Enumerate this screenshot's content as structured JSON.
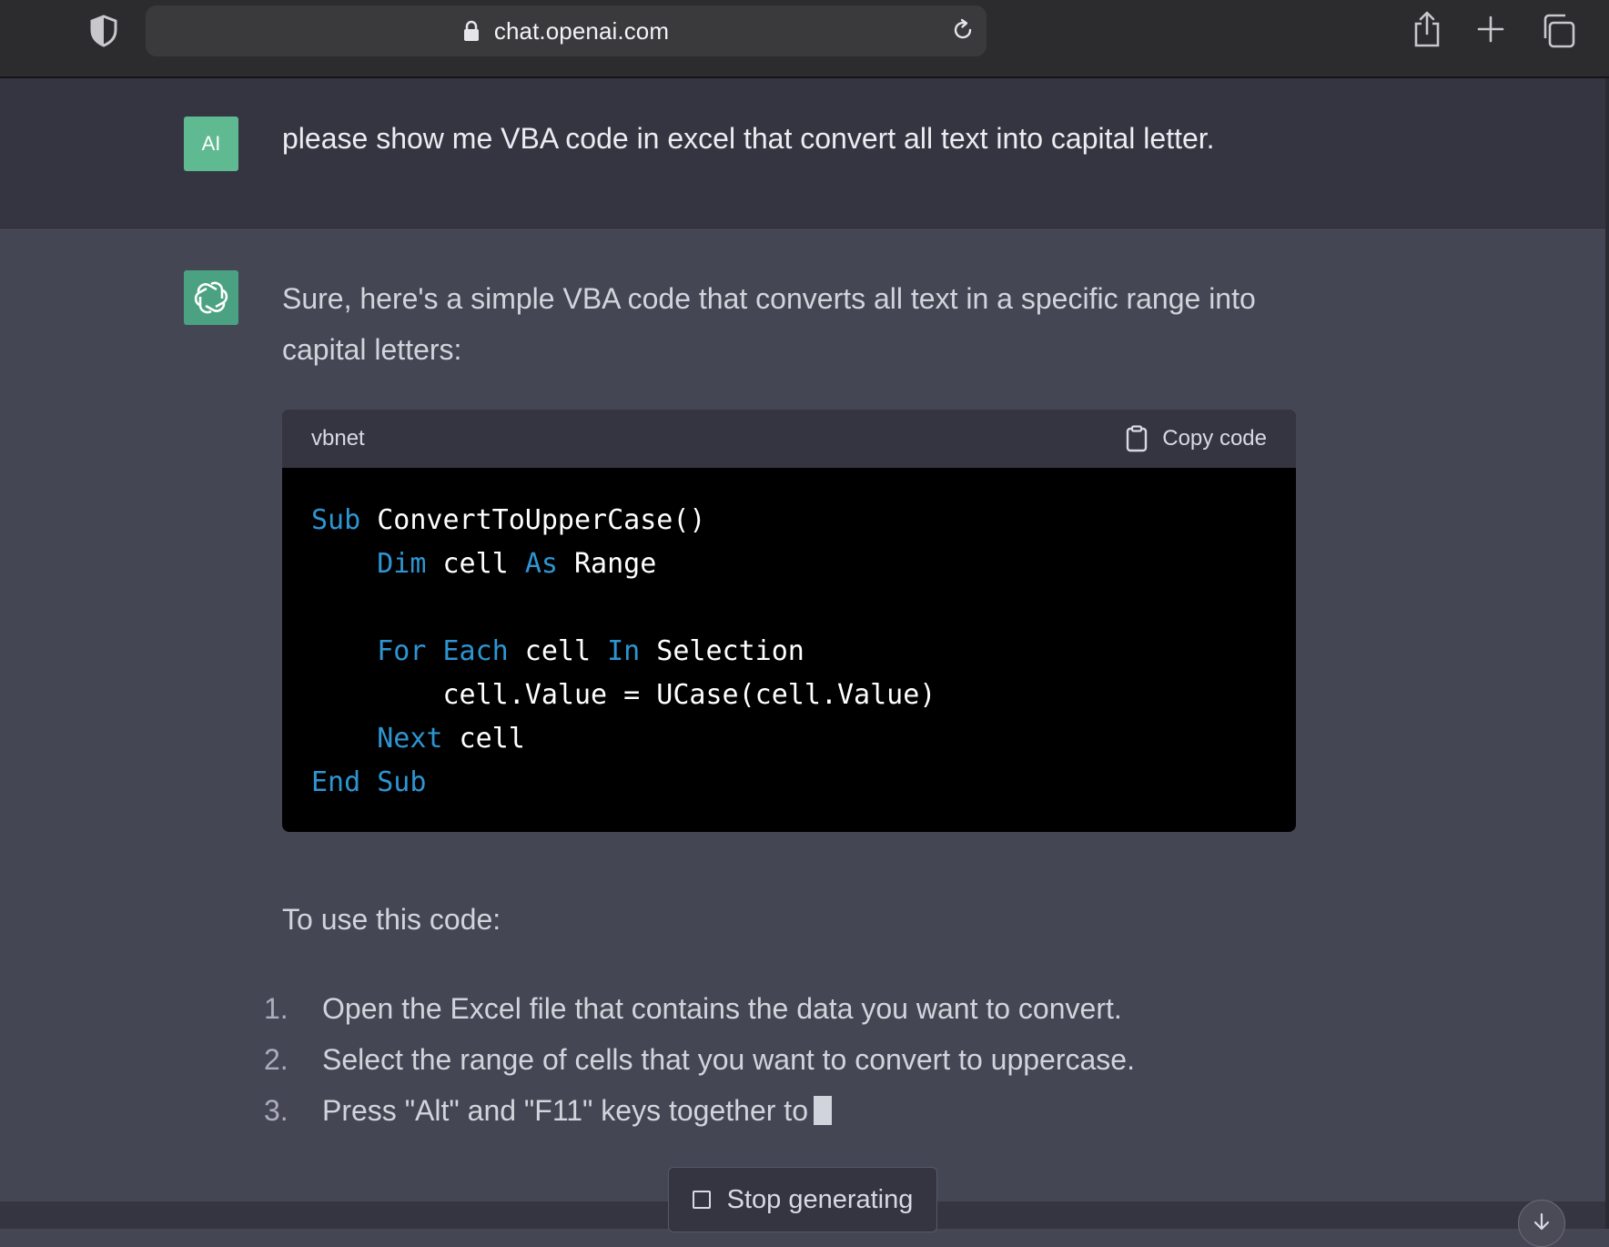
{
  "browser": {
    "url": "chat.openai.com"
  },
  "conversation": {
    "user": {
      "avatar_label": "AI",
      "message": "please show me VBA code in excel that convert all text into capital letter."
    },
    "assistant": {
      "intro": "Sure, here's a simple VBA code that converts all text in a specific range into capital letters:",
      "code_block": {
        "language": "vbnet",
        "copy_label": "Copy code",
        "lines": [
          [
            {
              "t": "Sub",
              "k": true
            },
            {
              "t": " ConvertToUpperCase()"
            }
          ],
          [
            {
              "t": "    "
            },
            {
              "t": "Dim",
              "k": true
            },
            {
              "t": " cell "
            },
            {
              "t": "As",
              "k": true
            },
            {
              "t": " Range"
            }
          ],
          [
            {
              "t": ""
            }
          ],
          [
            {
              "t": "    "
            },
            {
              "t": "For",
              "k": true
            },
            {
              "t": " "
            },
            {
              "t": "Each",
              "k": true
            },
            {
              "t": " cell "
            },
            {
              "t": "In",
              "k": true
            },
            {
              "t": " Selection"
            }
          ],
          [
            {
              "t": "        cell.Value = UCase(cell.Value)"
            }
          ],
          [
            {
              "t": "    "
            },
            {
              "t": "Next",
              "k": true
            },
            {
              "t": " cell"
            }
          ],
          [
            {
              "t": "End",
              "k": true
            },
            {
              "t": " "
            },
            {
              "t": "Sub",
              "k": true
            }
          ]
        ]
      },
      "use_label": "To use this code:",
      "steps": [
        {
          "num": "1.",
          "text": "Open the Excel file that contains the data you want to convert."
        },
        {
          "num": "2.",
          "text": "Select the range of cells that you want to convert to uppercase."
        },
        {
          "num": "3.",
          "text": "Press \"Alt\" and \"F11\" keys together to"
        }
      ]
    }
  },
  "controls": {
    "stop_label": "Stop generating"
  },
  "colors": {
    "keyword": "#2e95d3",
    "user_avatar": "#5fb991",
    "bot_avatar": "#4aa283"
  },
  "icons": [
    "shield-icon",
    "lock-icon",
    "reload-icon",
    "share-icon",
    "new-tab-icon",
    "tabs-overview-icon",
    "openai-logo-icon",
    "clipboard-icon",
    "stop-icon",
    "arrow-down-icon"
  ]
}
